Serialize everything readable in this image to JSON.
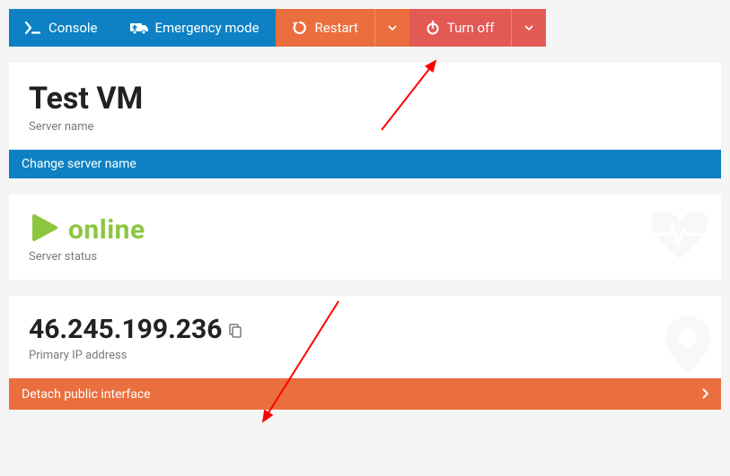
{
  "toolbar": {
    "console": "Console",
    "emergency": "Emergency mode",
    "restart": "Restart",
    "turnoff": "Turn off"
  },
  "server_name_card": {
    "title": "Test VM",
    "sub": "Server name",
    "action": "Change server name"
  },
  "status_card": {
    "status": "online",
    "sub": "Server status"
  },
  "ip_card": {
    "ip": "46.245.199.236",
    "sub": "Primary IP address",
    "action": "Detach public interface"
  }
}
